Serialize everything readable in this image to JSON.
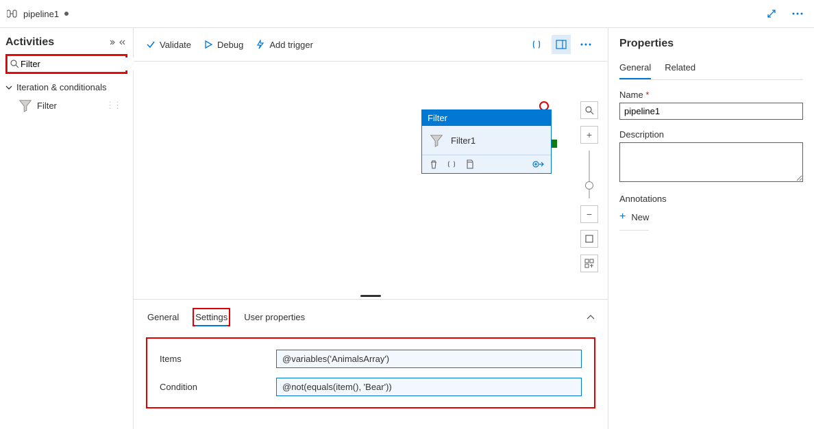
{
  "tab": {
    "title": "pipeline1"
  },
  "sidebar": {
    "title": "Activities",
    "search_value": "Filter",
    "group_label": "Iteration & conditionals",
    "filter_item": "Filter"
  },
  "toolbar": {
    "validate": "Validate",
    "debug": "Debug",
    "add_trigger": "Add trigger"
  },
  "node": {
    "type": "Filter",
    "name": "Filter1"
  },
  "bottom": {
    "tabs": {
      "general": "General",
      "settings": "Settings",
      "user_properties": "User properties"
    },
    "items_label": "Items",
    "items_value": "@variables('AnimalsArray')",
    "condition_label": "Condition",
    "condition_value": "@not(equals(item(), 'Bear'))"
  },
  "props": {
    "title": "Properties",
    "tabs": {
      "general": "General",
      "related": "Related"
    },
    "name_label": "Name",
    "name_value": "pipeline1",
    "desc_label": "Description",
    "annotations_label": "Annotations",
    "new_label": "New"
  }
}
